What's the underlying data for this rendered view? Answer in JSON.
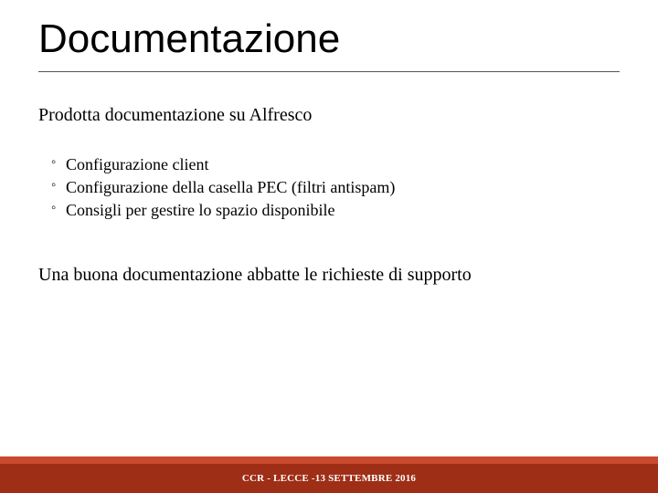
{
  "slide": {
    "title": "Documentazione",
    "intro": "Prodotta documentazione su Alfresco",
    "bullets": [
      "Configurazione client",
      "Configurazione della casella PEC (filtri antispam)",
      "Consigli per gestire lo spazio disponibile"
    ],
    "closing": "Una buona documentazione abbatte le richieste di supporto",
    "footer": "CCR - LECCE -13 SETTEMBRE 2016"
  }
}
